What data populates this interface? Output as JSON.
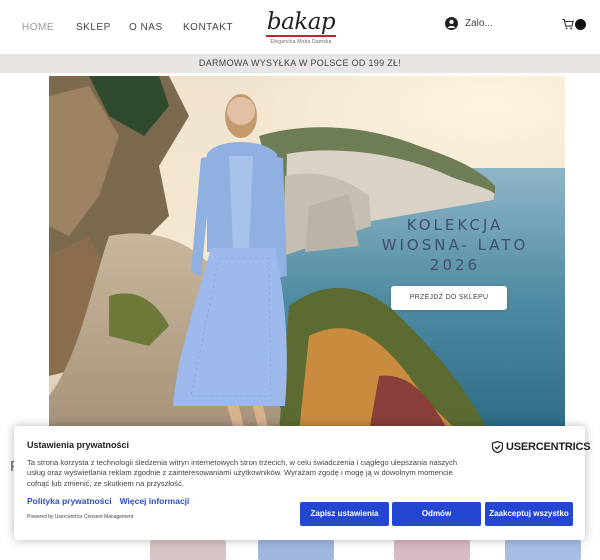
{
  "nav": {
    "items": [
      {
        "label": "HOME",
        "active": true
      },
      {
        "label": "SKLEP",
        "active": false
      },
      {
        "label": "O NAS",
        "active": false
      },
      {
        "label": "KONTAKT",
        "active": false
      }
    ]
  },
  "logo": {
    "word": "bakap",
    "tagline": "Elegancka Moda Damska"
  },
  "account": {
    "label": "Zalo...",
    "icon": "user-icon"
  },
  "cart": {
    "icon": "shopping-cart-icon"
  },
  "banner": {
    "text": "DARMOWA WYSYŁKA W POLSCE OD 199 ZŁ!"
  },
  "hero": {
    "title_lines": [
      "KOLEKCJA",
      "WIOSNA- LATO",
      "2026"
    ],
    "cta_label": "PRZEJDŹ DO SKLEPU"
  },
  "behind": {
    "letter": "F"
  },
  "consent": {
    "title": "Ustawienia prywatności",
    "brand": "USERCENTRICS",
    "text": "Ta strona korzysta z technologii śledzenia witryn internetowych stron trzecich, w celu świadczenia i ciągłego ulepszania naszych usług oraz wyświetlania reklam zgodnie z zainteresowaniami użytkowników. Wyrażam zgodę i mogę ją w dowolnym momencie cofnąć lub zmienić, ze skutkiem na przyszłość.",
    "privacy_link": "Polityka prywatności",
    "more_link": "Więcej informacji",
    "powered_by": "Powered by Usercentrics Consent Management",
    "buttons": {
      "settings": "Zapisz ustawienia",
      "deny": "Odmów",
      "accept": "Zaakceptuj wszystko"
    },
    "accent": "#2347d0"
  }
}
